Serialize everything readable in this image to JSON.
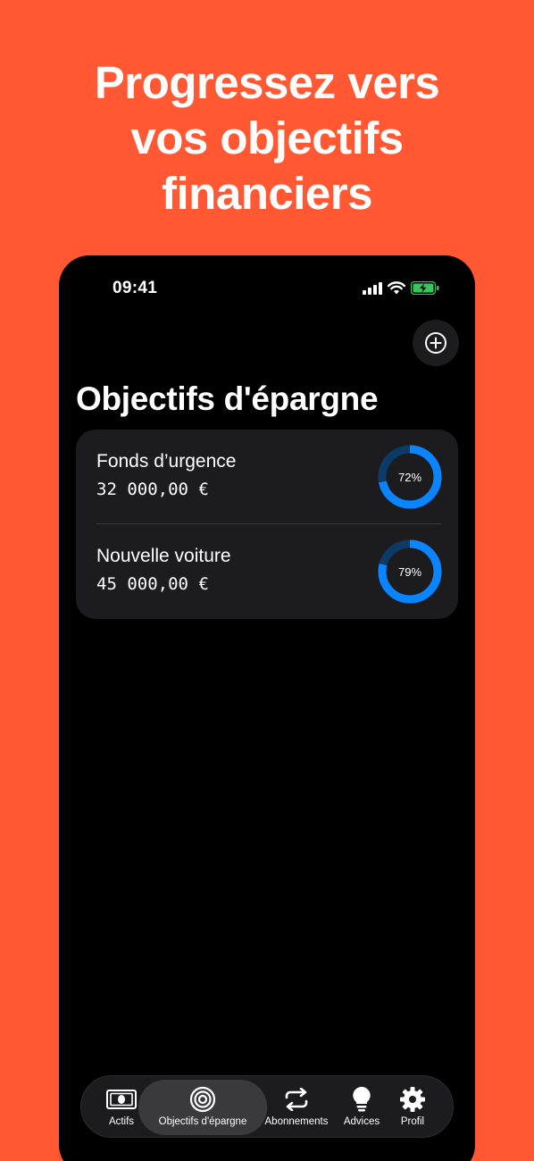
{
  "headline": {
    "line1": "Progressez vers",
    "line2": "vos objectifs",
    "line3": "financiers"
  },
  "status_bar": {
    "time": "09:41",
    "battery_color": "#34C759"
  },
  "page_title": "Objectifs d'épargne",
  "goals": [
    {
      "name": "Fonds d’urgence",
      "amount": "32 000,00 €",
      "percent_label": "72%",
      "progress": 0.72
    },
    {
      "name": "Nouvelle voiture",
      "amount": "45 000,00 €",
      "percent_label": "79%",
      "progress": 0.79
    }
  ],
  "tabs": [
    {
      "label": "Actifs",
      "icon": "banknote-icon"
    },
    {
      "label": "Objectifs d'épargne",
      "icon": "target-icon",
      "active": true
    },
    {
      "label": "Abonnements",
      "icon": "repeat-icon"
    },
    {
      "label": "Advices",
      "icon": "lightbulb-icon"
    },
    {
      "label": "Profil",
      "icon": "gear-icon"
    }
  ],
  "colors": {
    "background": "#FF5833",
    "accent": "#0A84FF",
    "ring_track": "#0B3B66"
  }
}
